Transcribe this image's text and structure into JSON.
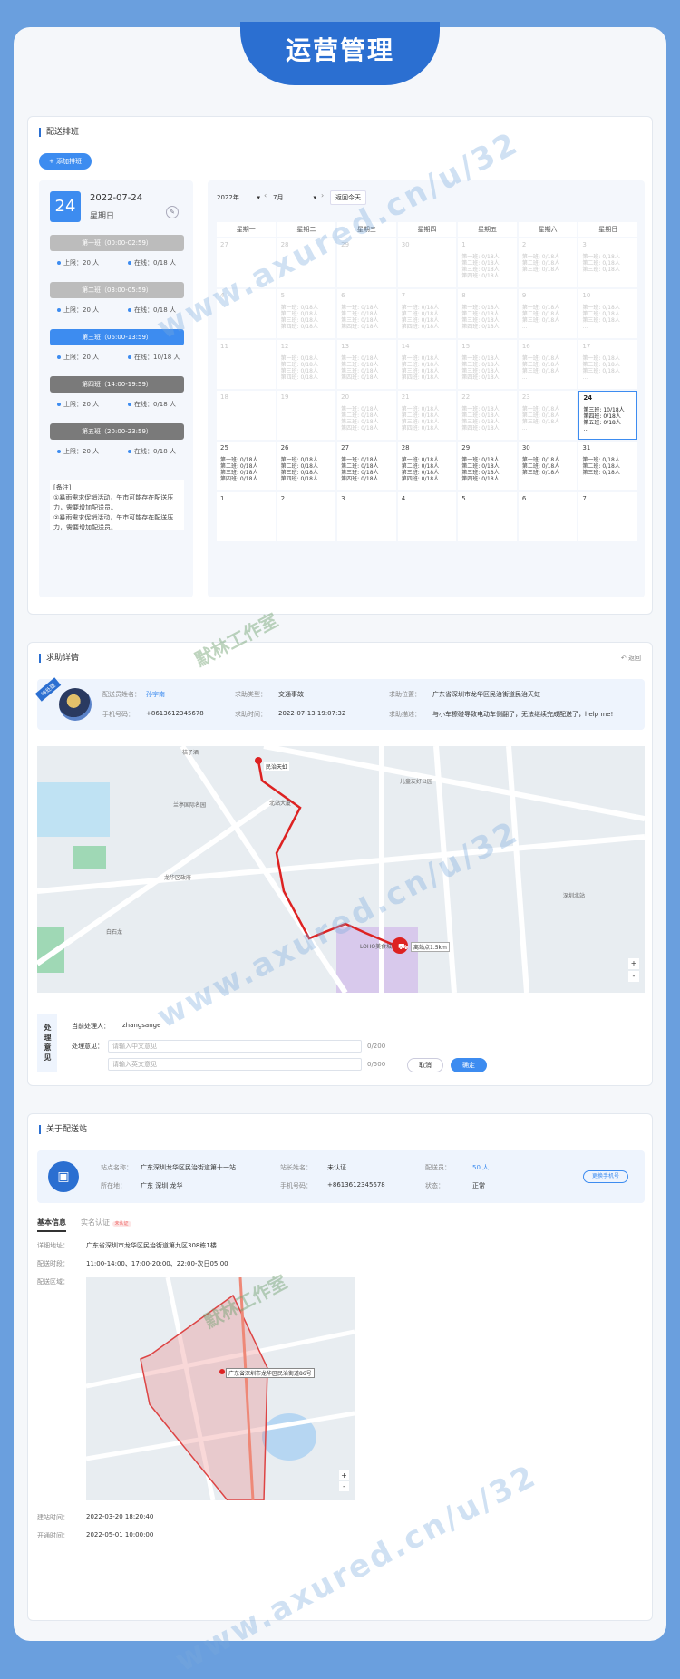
{
  "banner": {
    "title": "运营管理"
  },
  "schedule": {
    "section_title": "配送排班",
    "add_button": "+ 添加排班",
    "selected_day": "24",
    "selected_date": "2022-07-24",
    "selected_weekday": "星期日",
    "shifts": [
      {
        "name": "第一班（00:00-02:59）",
        "limit": "上限：20 人",
        "online": "在线：0/18 人",
        "color": "#bcbcbc"
      },
      {
        "name": "第二班（03:00-05:59）",
        "limit": "上限：20 人",
        "online": "在线：0/18 人",
        "color": "#bcbcbc"
      },
      {
        "name": "第三班（06:00-13:59）",
        "limit": "上限：20 人",
        "online": "在线：10/18 人",
        "color": "#3d8cf0"
      },
      {
        "name": "第四班（14:00-19:59）",
        "limit": "上限：20 人",
        "online": "在线：0/18 人",
        "color": "#7a7a7a"
      },
      {
        "name": "第五班（20:00-23:59）",
        "limit": "上限：20 人",
        "online": "在线：0/18 人",
        "color": "#7a7a7a"
      }
    ],
    "note_title": "[备注]",
    "note_lines": [
      "①暴雨需求促销活动，午市可能存在配送压力，需要增加配送员。",
      "②暴雨需求促销活动，午市可能存在配送压力，需要增加配送员。"
    ],
    "year_select": "2022年",
    "month_select": "7月",
    "today_button": "返回今天",
    "weekdays": [
      "星期一",
      "星期二",
      "星期三",
      "星期四",
      "星期五",
      "星期六",
      "星期日"
    ],
    "weeks": [
      [
        {
          "d": "27",
          "t": []
        },
        {
          "d": "28",
          "t": []
        },
        {
          "d": "29",
          "t": []
        },
        {
          "d": "30",
          "t": []
        },
        {
          "d": "1",
          "t": [
            "第一班: 0/18人",
            "第二班: 0/18人",
            "第三班: 0/18人",
            "第四班: 0/18人"
          ]
        },
        {
          "d": "2",
          "t": [
            "第一班: 0/18人",
            "第二班: 0/18人",
            "第三班: 0/18人",
            "..."
          ]
        },
        {
          "d": "3",
          "t": [
            "第一班: 0/18人",
            "第二班: 0/18人",
            "第三班: 0/18人",
            "..."
          ]
        }
      ],
      [
        {
          "d": "4",
          "t": []
        },
        {
          "d": "5",
          "t": [
            "第一班: 0/18人",
            "第二班: 0/18人",
            "第三班: 0/18人",
            "第四班: 0/18人"
          ]
        },
        {
          "d": "6",
          "t": [
            "第一班: 0/18人",
            "第二班: 0/18人",
            "第三班: 0/18人",
            "第四班: 0/18人"
          ]
        },
        {
          "d": "7",
          "t": [
            "第一班: 0/18人",
            "第二班: 0/18人",
            "第三班: 0/18人",
            "第四班: 0/18人"
          ]
        },
        {
          "d": "8",
          "t": [
            "第一班: 0/18人",
            "第二班: 0/18人",
            "第三班: 0/18人",
            "第四班: 0/18人"
          ]
        },
        {
          "d": "9",
          "t": [
            "第一班: 0/18人",
            "第二班: 0/18人",
            "第三班: 0/18人",
            "..."
          ]
        },
        {
          "d": "10",
          "t": [
            "第一班: 0/18人",
            "第二班: 0/18人",
            "第三班: 0/18人",
            "..."
          ]
        }
      ],
      [
        {
          "d": "11",
          "t": []
        },
        {
          "d": "12",
          "t": [
            "第一班: 0/18人",
            "第二班: 0/18人",
            "第三班: 0/18人",
            "第四班: 0/18人"
          ]
        },
        {
          "d": "13",
          "t": [
            "第一班: 0/18人",
            "第二班: 0/18人",
            "第三班: 0/18人",
            "第四班: 0/18人"
          ]
        },
        {
          "d": "14",
          "t": [
            "第一班: 0/18人",
            "第二班: 0/18人",
            "第三班: 0/18人",
            "第四班: 0/18人"
          ]
        },
        {
          "d": "15",
          "t": [
            "第一班: 0/18人",
            "第二班: 0/18人",
            "第三班: 0/18人",
            "第四班: 0/18人"
          ]
        },
        {
          "d": "16",
          "t": [
            "第一班: 0/18人",
            "第二班: 0/18人",
            "第三班: 0/18人",
            "..."
          ]
        },
        {
          "d": "17",
          "t": [
            "第一班: 0/18人",
            "第二班: 0/18人",
            "第三班: 0/18人",
            "..."
          ]
        }
      ],
      [
        {
          "d": "18",
          "t": []
        },
        {
          "d": "19",
          "t": []
        },
        {
          "d": "20",
          "t": [
            "第一班: 0/18人",
            "第二班: 0/18人",
            "第三班: 0/18人",
            "第四班: 0/18人"
          ]
        },
        {
          "d": "21",
          "t": [
            "第一班: 0/18人",
            "第二班: 0/18人",
            "第三班: 0/18人",
            "第四班: 0/18人"
          ]
        },
        {
          "d": "22",
          "t": [
            "第一班: 0/18人",
            "第二班: 0/18人",
            "第三班: 0/18人",
            "第四班: 0/18人"
          ]
        },
        {
          "d": "23",
          "t": [
            "第一班: 0/18人",
            "第二班: 0/18人",
            "第三班: 0/18人",
            "..."
          ]
        },
        {
          "d": "24",
          "t": [
            "第三班: 10/18人",
            "第四班: 0/18人",
            "第五班: 0/18人",
            "..."
          ],
          "today": true
        }
      ],
      [
        {
          "d": "25",
          "t": [
            "第一班: 0/18人",
            "第二班: 0/18人",
            "第三班: 0/18人",
            "第四班: 0/18人"
          ],
          "cur": true
        },
        {
          "d": "26",
          "t": [
            "第一班: 0/18人",
            "第二班: 0/18人",
            "第三班: 0/18人",
            "第四班: 0/18人"
          ],
          "cur": true
        },
        {
          "d": "27",
          "t": [
            "第一班: 0/18人",
            "第二班: 0/18人",
            "第三班: 0/18人",
            "第四班: 0/18人"
          ],
          "cur": true
        },
        {
          "d": "28",
          "t": [
            "第一班: 0/18人",
            "第二班: 0/18人",
            "第三班: 0/18人",
            "第四班: 0/18人"
          ],
          "cur": true
        },
        {
          "d": "29",
          "t": [
            "第一班: 0/18人",
            "第二班: 0/18人",
            "第三班: 0/18人",
            "第四班: 0/18人"
          ],
          "cur": true
        },
        {
          "d": "30",
          "t": [
            "第一班: 0/18人",
            "第二班: 0/18人",
            "第三班: 0/18人",
            "..."
          ],
          "cur": true
        },
        {
          "d": "31",
          "t": [
            "第一班: 0/18人",
            "第二班: 0/18人",
            "第三班: 0/18人",
            "..."
          ],
          "cur": true
        }
      ],
      [
        {
          "d": "1",
          "t": [],
          "cur": true
        },
        {
          "d": "2",
          "t": [],
          "cur": true
        },
        {
          "d": "3",
          "t": [],
          "cur": true
        },
        {
          "d": "4",
          "t": [],
          "cur": true
        },
        {
          "d": "5",
          "t": [],
          "cur": true
        },
        {
          "d": "6",
          "t": [],
          "cur": true
        },
        {
          "d": "7",
          "t": [],
          "cur": true
        }
      ]
    ]
  },
  "help": {
    "section_title": "求助详情",
    "back_link": "返回",
    "badge": "待处理",
    "courier_name_label": "配送员姓名：",
    "courier_name": "孙宇南",
    "phone_label": "手机号码：",
    "phone": "+8613612345678",
    "type_label": "求助类型：",
    "type": "交通事故",
    "time_label": "求助时间：",
    "time": "2022-07-13 19:07:32",
    "location_label": "求助位置：",
    "location": "广东省深圳市龙华区民治街道民治天虹",
    "desc_label": "求助描述：",
    "desc": "与小车擦碰导致电动车侧翻了，无法继续完成配送了，help me!",
    "map_labels": [
      "桔子酒",
      "民治天虹",
      "北站大厦",
      "兰亭国际名园",
      "龙华区政府",
      "LOHO美食城",
      "儿童友好公园",
      "深圳北站",
      "白石龙"
    ],
    "distance_tag": "离站点1.5km",
    "handle_title": "处理意见",
    "handler_label": "当前处理人：",
    "handler": "zhangsange",
    "opinion_label": "处理意见：",
    "cn_placeholder": "请输入中文意见",
    "en_placeholder": "请输入英文意见",
    "cn_count": "0/200",
    "en_count": "0/500",
    "cancel_button": "取消",
    "confirm_button": "确定"
  },
  "station": {
    "section_title": "关于配送站",
    "name_label": "站点名称：",
    "name": "广东深圳龙华区民治街道第十一站",
    "area_label": "所在地：",
    "area": "广东 深圳 龙华",
    "manager_label": "站长姓名：",
    "manager": "未认证",
    "mphone_label": "手机号码：",
    "mphone": "+8613612345678",
    "couriers_label": "配送员：",
    "couriers": "50 人",
    "status_label": "状态：",
    "status": "正常",
    "change_phone_button": "更换手机号",
    "tab_basic": "基本信息",
    "tab_verify": "实名认证",
    "verify_badge": "未认证",
    "address_label": "详细地址：",
    "address": "广东省深圳市龙华区民治街道第九区308栋1楼",
    "hours_label": "配送时段：",
    "hours": "11:00-14:00、17:00-20:00、22:00-次日05:00",
    "region_label": "配送区域：",
    "map_pin_label": "广东省深圳市龙华区民治街道86号",
    "created_label": "建站时间：",
    "created": "2022-03-20 18:20:40",
    "opened_label": "开通时间：",
    "opened": "2022-05-01 10:00:00"
  },
  "watermarks": [
    "www.axured.cn/u/32",
    "默林工作室"
  ]
}
